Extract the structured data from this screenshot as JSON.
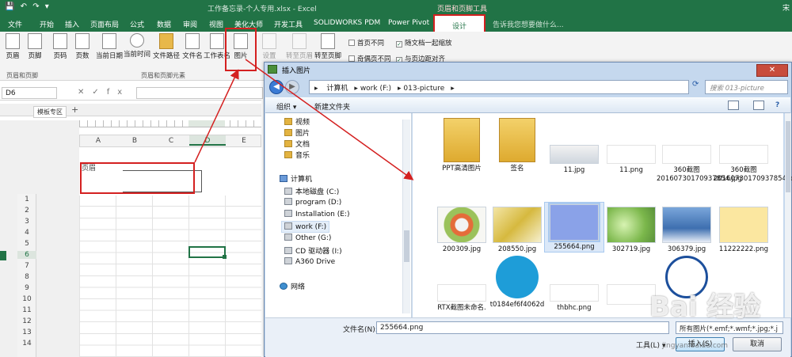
{
  "window": {
    "title": "工作备忘录-个人专用.xlsx - Excel",
    "contextual_tab": "页眉和页脚工具",
    "search_hint": "告诉我您想要做什么...",
    "user": "宋"
  },
  "tabs": [
    "文件",
    "开始",
    "插入",
    "页面布局",
    "公式",
    "数据",
    "审阅",
    "视图",
    "美化大师",
    "开发工具",
    "SOLIDWORKS PDM",
    "Power Pivot",
    "设计"
  ],
  "ribbon": {
    "buttons": [
      {
        "label": "页眉",
        "group": 0
      },
      {
        "label": "页脚",
        "group": 0
      },
      {
        "label": "页码",
        "group": 1
      },
      {
        "label": "页数",
        "group": 1
      },
      {
        "label": "当前日期",
        "group": 1
      },
      {
        "label": "当前时间",
        "group": 1
      },
      {
        "label": "文件路径",
        "group": 1
      },
      {
        "label": "文件名",
        "group": 1
      },
      {
        "label": "工作表名",
        "group": 1
      },
      {
        "label": "图片",
        "group": 1
      },
      {
        "label": "设置",
        "group": 1,
        "disabled": true
      },
      {
        "label": "转至页眉",
        "group": 2,
        "disabled": true
      },
      {
        "label": "转至页脚",
        "group": 2
      }
    ],
    "groups": [
      "页眉和页脚",
      "页眉和页脚元素"
    ],
    "options": [
      {
        "label": "首页不同",
        "checked": false
      },
      {
        "label": "随文档一起缩放",
        "checked": true
      },
      {
        "label": "奇偶页不同",
        "checked": false
      },
      {
        "label": "与页边距对齐",
        "checked": true
      }
    ]
  },
  "formula_bar": {
    "name_box": "D6",
    "fx": "fx",
    "value": ""
  },
  "sheet_tab": "模板专区",
  "sheet": {
    "columns": [
      "A",
      "B",
      "C",
      "D",
      "E"
    ],
    "selected_column": "D",
    "rows": [
      "1",
      "2",
      "3",
      "4",
      "5",
      "6",
      "7",
      "8",
      "9",
      "10",
      "11",
      "12",
      "13",
      "14"
    ],
    "selected_row": "6",
    "header_label": "页眉"
  },
  "dialog": {
    "title": "插入图片",
    "close": "✕",
    "path": [
      "计算机",
      "work (F:)",
      "013-picture"
    ],
    "search_placeholder": "搜索 013-picture",
    "organize": "组织 ▾",
    "new_folder": "新建文件夹",
    "nav": [
      {
        "label": "视频",
        "kind": "lib"
      },
      {
        "label": "图片",
        "kind": "lib"
      },
      {
        "label": "文档",
        "kind": "lib"
      },
      {
        "label": "音乐",
        "kind": "lib"
      },
      {
        "label": "计算机",
        "kind": "pc"
      },
      {
        "label": "本地磁盘 (C:)",
        "kind": "drv"
      },
      {
        "label": "program (D:)",
        "kind": "drv"
      },
      {
        "label": "Installation (E:)",
        "kind": "drv"
      },
      {
        "label": "work (F:)",
        "kind": "drv",
        "selected": true
      },
      {
        "label": "Other (G:)",
        "kind": "drv"
      },
      {
        "label": "CD 驱动器 (I:)",
        "kind": "drv"
      },
      {
        "label": "A360 Drive",
        "kind": "drv"
      },
      {
        "label": "网络",
        "kind": "net"
      }
    ],
    "files": [
      {
        "name": "PPT高清图片",
        "thumb": "folder"
      },
      {
        "name": "签名",
        "thumb": "folder"
      },
      {
        "name": "11.jpg",
        "thumb": "grey"
      },
      {
        "name": "11.png",
        "thumb": "logo"
      },
      {
        "name": "360截图20160730170937854.jpg",
        "thumb": "logo"
      },
      {
        "name": "360截图20160730170937854.png",
        "thumb": "logo"
      },
      {
        "name": "200309.jpg",
        "thumb": "flower"
      },
      {
        "name": "208550.jpg",
        "thumb": "yel"
      },
      {
        "name": "255664.png",
        "thumb": "star",
        "selected": true
      },
      {
        "name": "302719.jpg",
        "thumb": "green"
      },
      {
        "name": "306379.jpg",
        "thumb": "blue"
      },
      {
        "name": "11222222.png",
        "thumb": "tape"
      },
      {
        "name": "RTX截图未命名.",
        "thumb": "logo"
      },
      {
        "name": "t0184ef6f4062d",
        "thumb": "house"
      },
      {
        "name": "thbhc.png",
        "thumb": "logo"
      },
      {
        "name": "",
        "thumb": "logo"
      },
      {
        "name": "",
        "thumb": "haiyun"
      }
    ],
    "filename_label": "文件名(N):",
    "filename_value": "255664.png",
    "filetype": "所有图片(*.emf;*.wmf;*.jpg;*.j",
    "tools": "工具(L) ▾",
    "insert": "插入(S)",
    "cancel": "取消"
  },
  "watermark": {
    "text": "Bai 经验",
    "url": "jingyan.baidu.com"
  },
  "colors": {
    "excel_green": "#217346",
    "highlight_red": "#d42020"
  }
}
